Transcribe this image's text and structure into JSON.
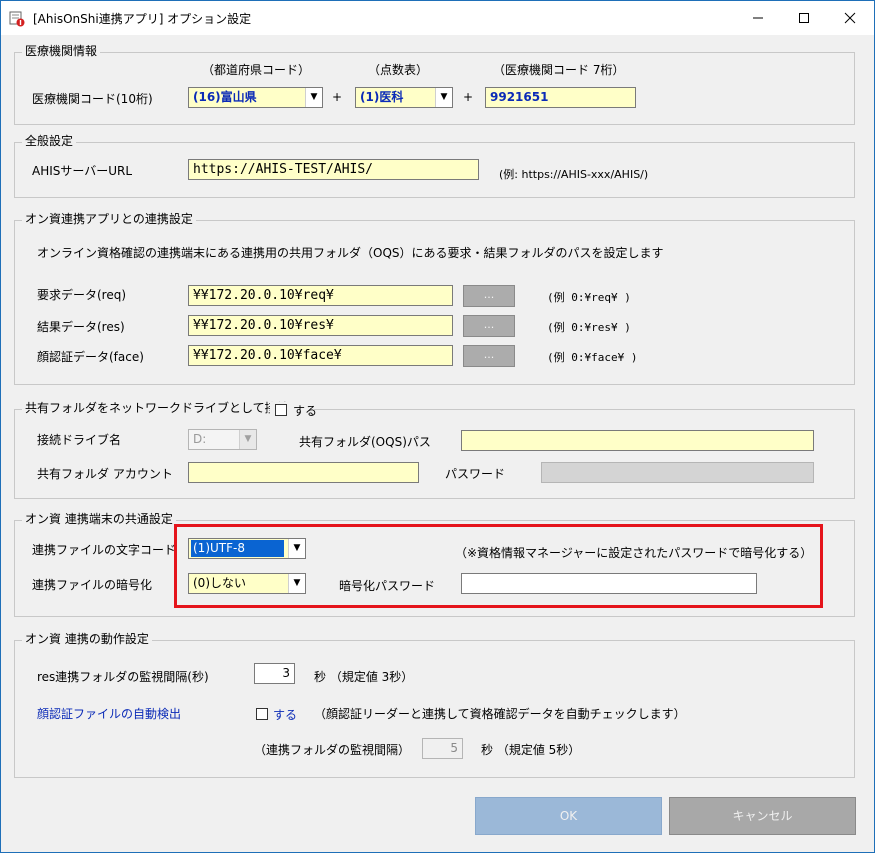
{
  "window": {
    "title": "[AhisOnShi連携アプリ] オプション設定",
    "minimize": "—",
    "maximize": "☐",
    "close": "✕"
  },
  "medical": {
    "legend": "医療機関情報",
    "pref_header": "（都道府県コード）",
    "score_header": "（点数表）",
    "code_header": "（医療機関コード 7桁）",
    "label": "医療機関コード(10桁)",
    "pref_value": "(16)富山県",
    "plus": "+",
    "score_value": "(1)医科",
    "code_value": "9921651"
  },
  "general": {
    "legend": "全般設定",
    "url_label": "AHISサーバーURL",
    "url_value": "https://AHIS-TEST/AHIS/",
    "url_example": "(例: https://AHIS-xxx/AHIS/)"
  },
  "link": {
    "legend": "オン資連携アプリとの連携設定",
    "desc": "オンライン資格確認の連携端末にある連携用の共用フォルダ（OQS）にある要求・結果フォルダのパスを設定します",
    "rows": [
      {
        "label": "要求データ(req)",
        "value": "¥¥172.20.0.10¥req¥",
        "button": "...",
        "example": "(例 0:¥req¥ )"
      },
      {
        "label": "結果データ(res)",
        "value": "¥¥172.20.0.10¥res¥",
        "button": "...",
        "example": "(例 0:¥res¥ )"
      },
      {
        "label": "顔認証データ(face)",
        "value": "¥¥172.20.0.10¥face¥",
        "button": "...",
        "example": "(例 0:¥face¥ )"
      }
    ]
  },
  "netdrive": {
    "legend": "共有フォルダをネットワークドライブとして接続",
    "checkbox_label": "する",
    "drive_label": "接続ドライブ名",
    "drive_value": "D:",
    "path_label": "共有フォルダ(OQS)パス",
    "path_value": "",
    "account_label": "共有フォルダ アカウント",
    "account_value": "",
    "password_label": "パスワード",
    "password_value": ""
  },
  "common": {
    "legend": "オン資 連携端末の共通設定",
    "charset_label": "連携ファイルの文字コード",
    "charset_value": "(1)UTF-8",
    "note": "（※資格情報マネージャーに設定されたパスワードで暗号化する）",
    "encrypt_label": "連携ファイルの暗号化",
    "encrypt_value": "(0)しない",
    "enc_pw_label": "暗号化パスワード",
    "enc_pw_value": ""
  },
  "behavior": {
    "legend": "オン資 連携の動作設定",
    "interval_label": "res連携フォルダの監視間隔(秒)",
    "interval_value": "3",
    "interval_suffix": "秒 （規定値 3秒）",
    "autodetect_label": "顔認証ファイルの自動検出",
    "autodetect_check_label": "する",
    "autodetect_note": "（顔認証リーダーと連携して資格確認データを自動チェックします）",
    "folder_interval_label": "（連携フォルダの監視間隔）",
    "folder_interval_value": "5",
    "folder_interval_suffix": "秒 （規定値 5秒）"
  },
  "buttons": {
    "ok": "OK",
    "cancel": "キャンセル"
  },
  "colors": {
    "field_bg": "#ffffc8",
    "selection": "#0a64d2",
    "highlight_border": "#e5141b",
    "link_text": "#0b2bb7"
  }
}
